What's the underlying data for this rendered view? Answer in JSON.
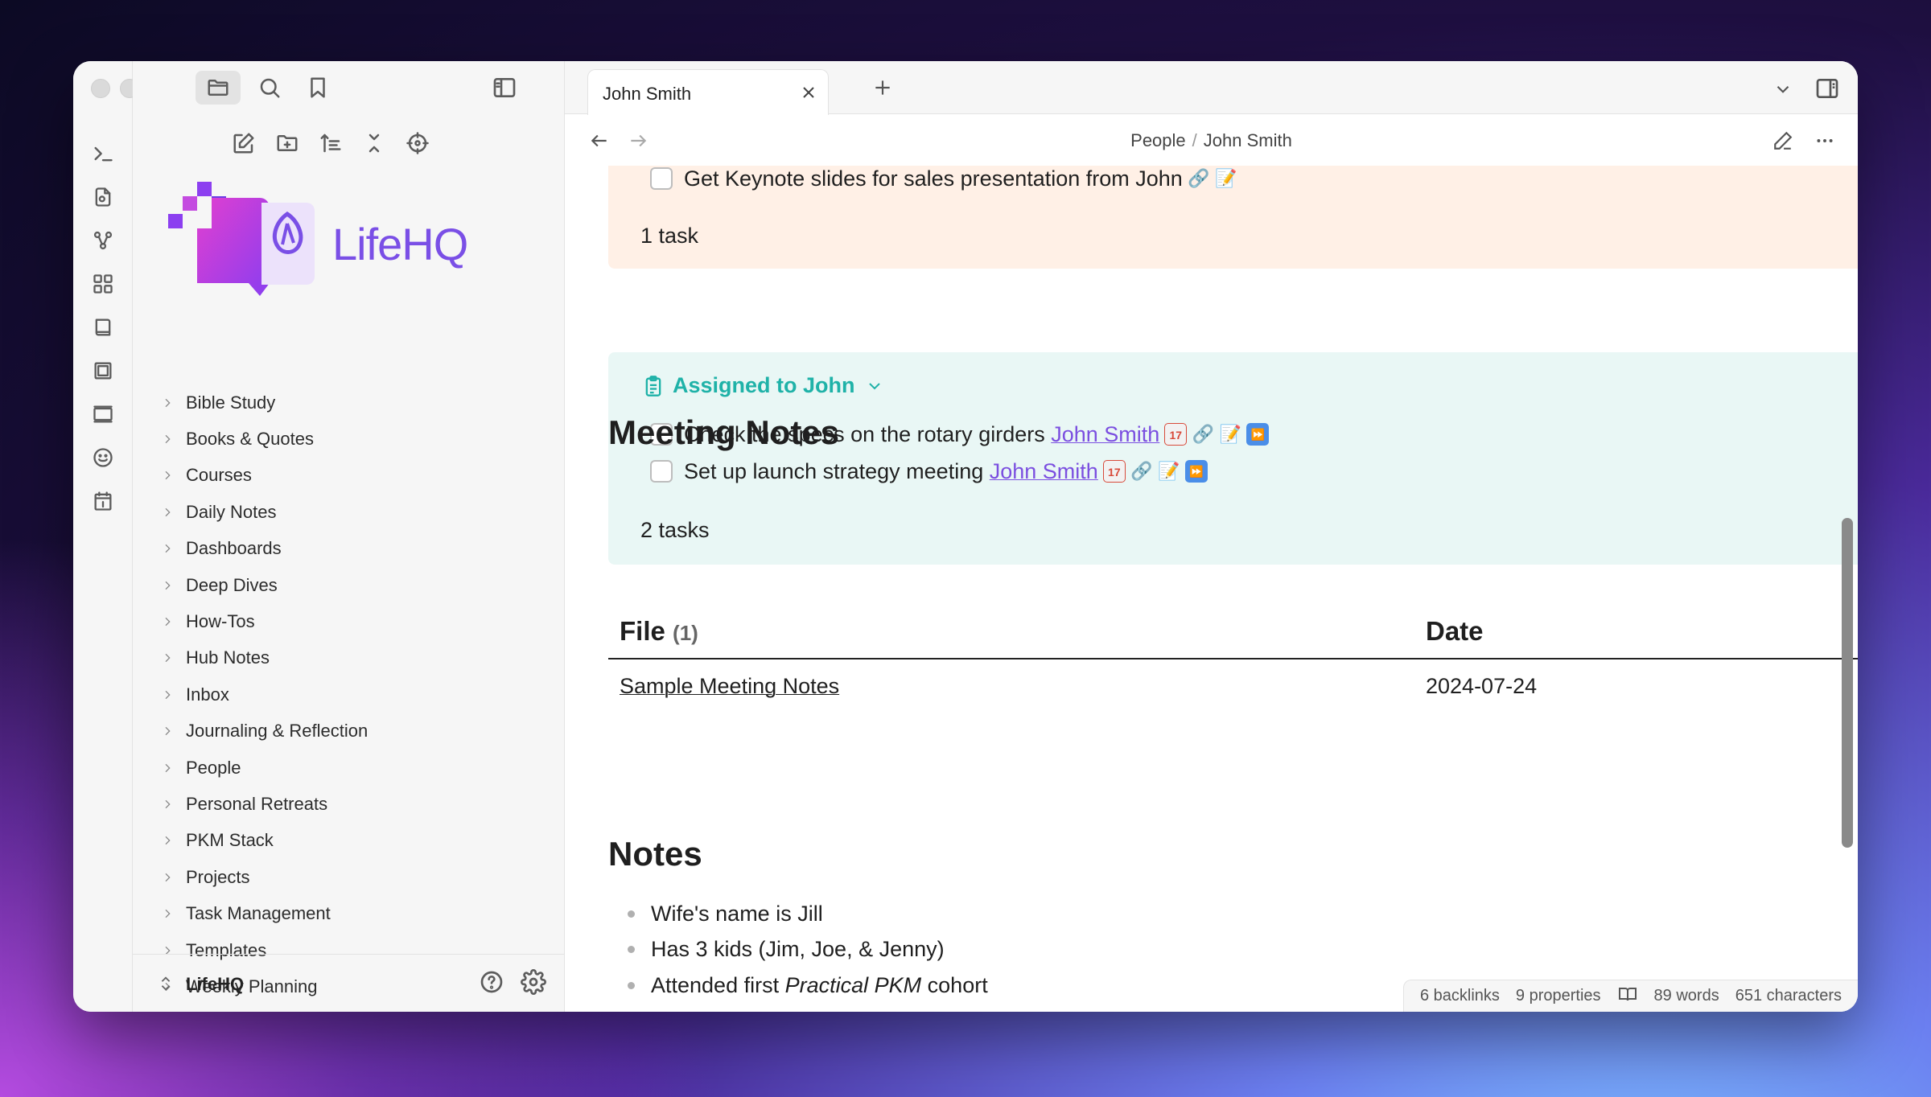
{
  "app": {
    "tab_title": "John Smith",
    "breadcrumb": [
      "People",
      "John Smith"
    ]
  },
  "sidebar": {
    "logo_text": "LifeHQ",
    "folders": [
      "Bible Study",
      "Books & Quotes",
      "Courses",
      "Daily Notes",
      "Dashboards",
      "Deep Dives",
      "How-Tos",
      "Hub Notes",
      "Inbox",
      "Journaling & Reflection",
      "People",
      "Personal Retreats",
      "PKM Stack",
      "Projects",
      "Task Management",
      "Templates",
      "Weekly Planning"
    ],
    "vault_name": "LifeHQ"
  },
  "tasks_from_john": {
    "items": [
      {
        "text": "Get Keynote slides for sales presentation from John"
      }
    ],
    "count": "1 task"
  },
  "assigned_to_john": {
    "heading": "Assigned to John",
    "items": [
      {
        "text": "Check the specs on the rotary girders",
        "link": "John Smith"
      },
      {
        "text": "Set up launch strategy meeting",
        "link": "John Smith"
      }
    ],
    "count": "2 tasks"
  },
  "meeting_notes": {
    "heading": "Meeting Notes",
    "columns": {
      "file": "File",
      "file_count": "(1)",
      "date": "Date"
    },
    "rows": [
      {
        "file": "Sample Meeting Notes",
        "date": "2024-07-24"
      }
    ]
  },
  "notes": {
    "heading": "Notes",
    "items": [
      "Wife's name is Jill",
      "Has 3 kids (Jim, Joe, & Jenny)",
      "Attended first"
    ],
    "italic_text": "Practical PKM",
    "item3_suffix": " cohort"
  },
  "status": {
    "backlinks": "6 backlinks",
    "properties": "9 properties",
    "words": "89 words",
    "characters": "651 characters"
  },
  "emoji": {
    "calendar": "17",
    "link": "🔗",
    "memo": "📝",
    "fast_forward": "⏩"
  }
}
